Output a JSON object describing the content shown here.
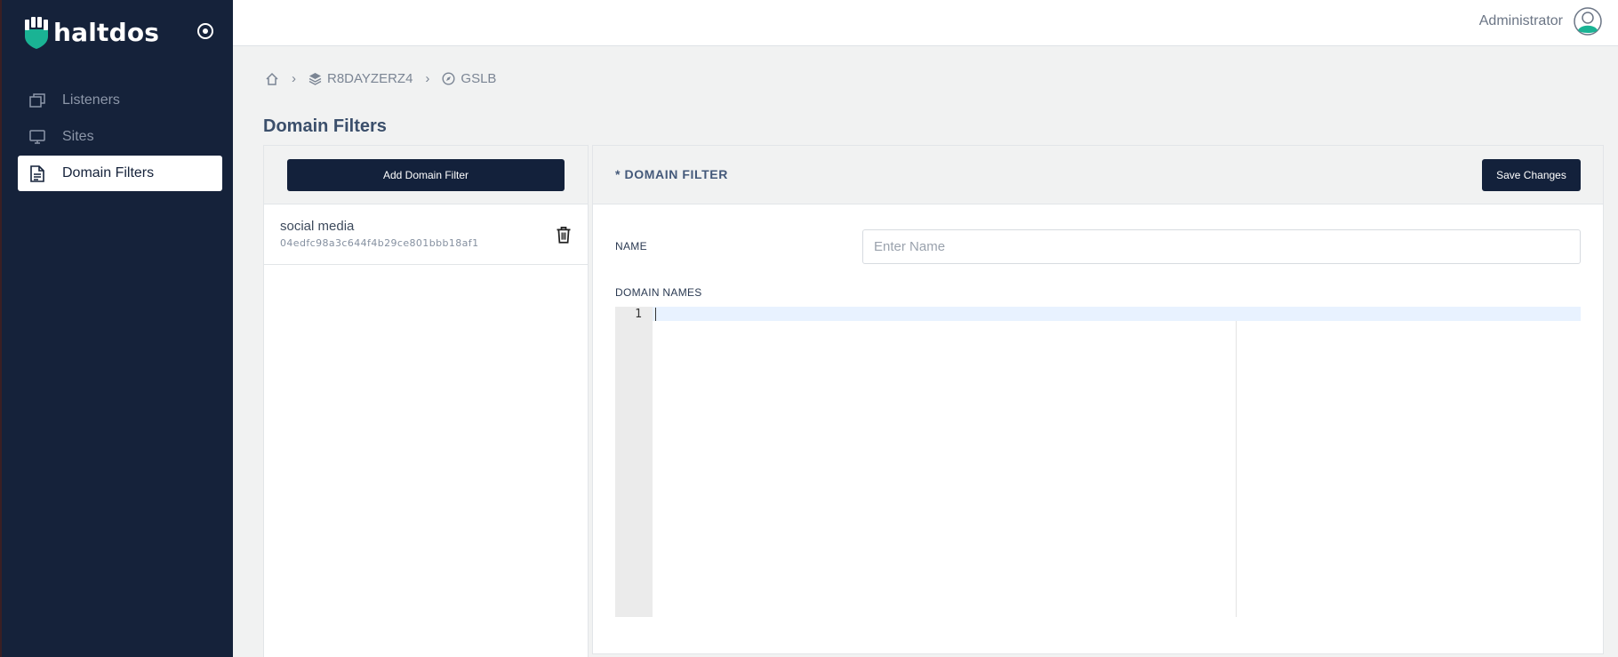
{
  "app": {
    "brand": "haltdos",
    "accent_color": "#1ab394",
    "sidebar_color": "#15223a"
  },
  "sidebar": {
    "toggle_icon": "target-icon",
    "items": [
      {
        "label": "Listeners",
        "icon": "windows-stack-icon",
        "active": false
      },
      {
        "label": "Sites",
        "icon": "monitor-icon",
        "active": false
      },
      {
        "label": "Domain Filters",
        "icon": "document-icon",
        "active": true
      }
    ]
  },
  "header": {
    "user_name": "Administrator",
    "avatar_icon": "user-avatar-icon"
  },
  "breadcrumb": {
    "items": [
      {
        "label": "",
        "icon": "home-icon"
      },
      {
        "label": "R8DAYZERZ4",
        "icon": "layers-icon"
      },
      {
        "label": "GSLB",
        "icon": "compass-icon"
      }
    ],
    "separator": "›"
  },
  "page": {
    "title": "Domain Filters"
  },
  "list": {
    "add_button_label": "Add Domain Filter",
    "items": [
      {
        "name": "social media",
        "id": "04edfc98a3c644f4b29ce801bbb18af1",
        "delete_icon": "trash-icon"
      }
    ]
  },
  "editor": {
    "title": "* DOMAIN FILTER",
    "save_label": "Save Changes",
    "name_label": "NAME",
    "name_value": "",
    "name_placeholder": "Enter Name",
    "domains_label": "DOMAIN NAMES",
    "line_numbers": [
      "1"
    ]
  }
}
